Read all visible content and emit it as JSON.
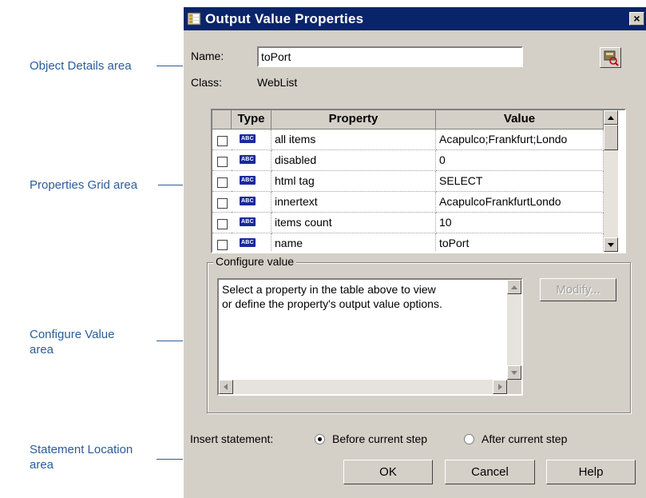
{
  "callouts": {
    "object_details": "Object Details area",
    "properties_grid": "Properties Grid area",
    "configure_value_line1": "Configure Value",
    "configure_value_line2": "area",
    "statement_location_line1": "Statement Location",
    "statement_location_line2": "area"
  },
  "dialog": {
    "title": "Output Value Properties",
    "close_glyph": "×",
    "name_label": "Name:",
    "name_value": "toPort",
    "class_label": "Class:",
    "class_value": "WebList"
  },
  "grid": {
    "columns": {
      "type": "Type",
      "property": "Property",
      "value": "Value"
    },
    "abc_badge": "ABC",
    "rows": [
      {
        "property": "all items",
        "value": "Acapulco;Frankfurt;Londo"
      },
      {
        "property": "disabled",
        "value": "0"
      },
      {
        "property": "html tag",
        "value": "SELECT"
      },
      {
        "property": "innertext",
        "value": " AcapulcoFrankfurtLondo"
      },
      {
        "property": "items count",
        "value": "10"
      },
      {
        "property": "name",
        "value": "toPort"
      }
    ]
  },
  "configure": {
    "group_label": "Configure value",
    "text_line1": "Select a property in the table above to view",
    "text_line2": "or define the property's output value options.",
    "modify_label": "Modify..."
  },
  "statement": {
    "label": "Insert statement:",
    "option_before": "Before current step",
    "option_after": "After current step",
    "selected": "before"
  },
  "buttons": {
    "ok": "OK",
    "cancel": "Cancel",
    "help": "Help"
  },
  "colors": {
    "callout": "#2a5d9a",
    "titlebar": "#0a246a",
    "dialog_bg": "#d4d0c8",
    "abc_badge": "#1a2a9a"
  }
}
